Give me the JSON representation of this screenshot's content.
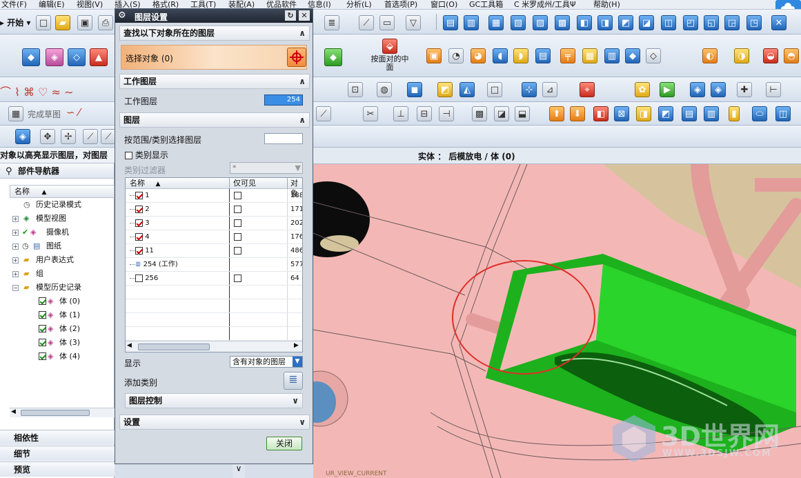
{
  "menubar": {
    "items": [
      "文件(F)",
      "编辑(E)",
      "视图(V)",
      "插入(S)",
      "格式(R)",
      "工具(T)",
      "装配(A)",
      "优品软件",
      "信息(I)",
      "分析(L)",
      "首选项(P)",
      "窗口(O)",
      "GC工具箱",
      "C 米罗成州/工具Ψ",
      "帮助(H)"
    ]
  },
  "toolbar": {
    "start_label": "开始",
    "finish_sketch_label": "完成草图",
    "center_btn_label": "按面对的中面",
    "hint_text": "对象以高亮显示图层，对图层"
  },
  "view_header": {
    "text": "实体 ： 后模放电 / 体 (0)"
  },
  "navigator": {
    "title": "部件导航器",
    "column_name": "名称",
    "rows": [
      "历史记录模式",
      "模型视图",
      "摄像机",
      "图纸",
      "用户表达式",
      "组",
      "模型历史记录",
      "体 (0)",
      "体 (1)",
      "体 (2)",
      "体 (3)",
      "体 (4)"
    ],
    "bottom_panels": [
      "相依性",
      "细节",
      "预览"
    ]
  },
  "dialog": {
    "title": "图层设置",
    "section_find": "查找以下对象所在的图层",
    "select_object_label": "选择对象 (0)",
    "section_work_layer": "工作图层",
    "work_layer_label": "工作图层",
    "work_layer_value": "254",
    "section_layers": "图层",
    "range_label": "按范围/类别选择图层",
    "range_value": "",
    "category_display_label": "类别显示",
    "category_filter_label": "类别过滤器",
    "category_filter_value": "*",
    "table": {
      "headers": [
        "名称",
        "仅可见",
        "对象"
      ],
      "rows": [
        {
          "name": "1",
          "checked": true,
          "visible_only": false,
          "count": "188"
        },
        {
          "name": "2",
          "checked": true,
          "visible_only": false,
          "count": "171"
        },
        {
          "name": "3",
          "checked": true,
          "visible_only": false,
          "count": "202"
        },
        {
          "name": "4",
          "checked": true,
          "visible_only": false,
          "count": "176"
        },
        {
          "name": "11",
          "checked": true,
          "visible_only": false,
          "count": "486"
        },
        {
          "name": "254 (工作)",
          "checked": null,
          "visible_only": null,
          "count": "577"
        },
        {
          "name": "256",
          "checked": false,
          "visible_only": false,
          "count": "64"
        }
      ]
    },
    "display_label": "显示",
    "display_value": "含有对象的图层",
    "add_category_label": "添加类别",
    "layer_control_label": "图层控制",
    "section_settings": "设置",
    "close_button": "关闭"
  },
  "statusbar": {
    "text": "UR_VIEW_CURRENT"
  },
  "watermark": {
    "title": "3D世界网",
    "url": "WWW.3DSJW.COM"
  },
  "colors": {
    "accent": "#f08a3c",
    "work_layer_field": "#3a8ee6",
    "highlight_green": "#22c422",
    "model_pink": "#f3b8b6"
  }
}
